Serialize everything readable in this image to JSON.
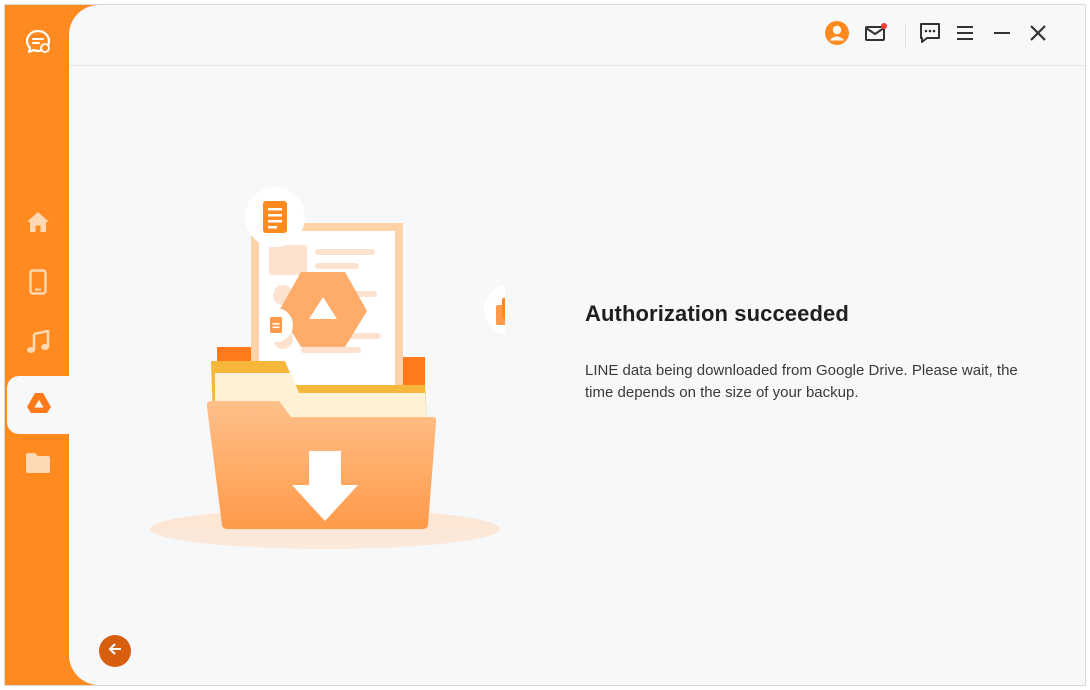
{
  "colors": {
    "accent": "#ff8a1f",
    "accent_dark": "#d85e0f",
    "panel_bg": "#f7f8fa"
  },
  "sidebar": {
    "logo_icon": "chat-bubble-logo-icon",
    "items": [
      {
        "id": "home",
        "icon": "home-icon",
        "active": false
      },
      {
        "id": "device",
        "icon": "phone-icon",
        "active": false
      },
      {
        "id": "music",
        "icon": "music-note-icon",
        "active": false
      },
      {
        "id": "google-drive",
        "icon": "google-drive-icon",
        "active": true
      },
      {
        "id": "files",
        "icon": "folder-icon",
        "active": false
      }
    ]
  },
  "topbar": {
    "icons": [
      "user-avatar-icon",
      "mail-icon",
      "feedback-icon",
      "menu-icon",
      "minimize-icon",
      "close-icon"
    ],
    "mail_has_notification": true
  },
  "main": {
    "title": "Authorization succeeded",
    "description": "LINE data being downloaded from Google Drive. Please wait, the time depends on the size of your backup."
  },
  "footer": {
    "back_icon": "back-arrow-icon"
  }
}
